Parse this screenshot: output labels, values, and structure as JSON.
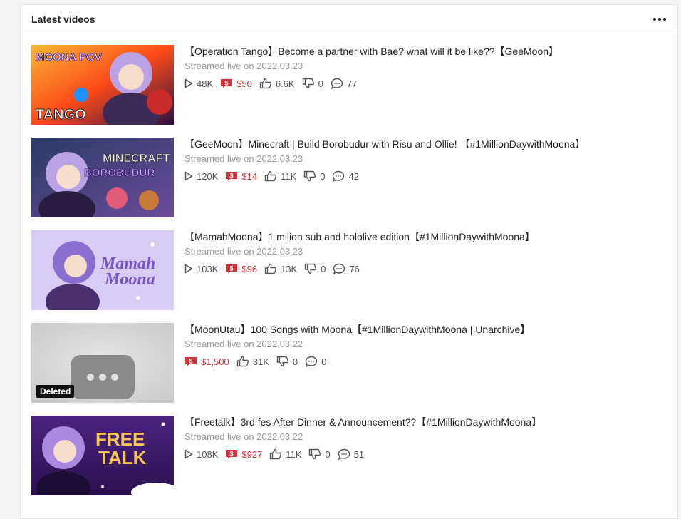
{
  "card": {
    "title": "Latest videos"
  },
  "videos": [
    {
      "title": "【Operation Tango】Become a partner with Bae? what will it be like??【GeeMoon】",
      "date": "Streamed live on 2022.03.23",
      "views": "48K",
      "superchat": "$50",
      "likes": "6.6K",
      "dislikes": "0",
      "comments": "77",
      "thumb_text": "MOONA POV",
      "thumb_text2": "TANGO"
    },
    {
      "title": "【GeeMoon】Minecraft | Build Borobudur with Risu and Ollie! 【#1MillionDaywithMoona】",
      "date": "Streamed live on 2022.03.23",
      "views": "120K",
      "superchat": "$14",
      "likes": "11K",
      "dislikes": "0",
      "comments": "42",
      "thumb_text": "MINECRAFT",
      "thumb_text2": "BOROBUDUR"
    },
    {
      "title": "【MamahMoona】1 milion sub and hololive edition【#1MillionDaywithMoona】",
      "date": "Streamed live on 2022.03.23",
      "views": "103K",
      "superchat": "$96",
      "likes": "13K",
      "dislikes": "0",
      "comments": "76",
      "thumb_text": "Mamah",
      "thumb_text2": "Moona"
    },
    {
      "title": "【MoonUtau】100 Songs with Moona【#1MillionDaywithMoona | Unarchive】",
      "date": "Streamed live on 2022.03.22",
      "superchat": "$1,500",
      "likes": "31K",
      "dislikes": "0",
      "comments": "0",
      "badge": "Deleted"
    },
    {
      "title": "【Freetalk】3rd fes After Dinner & Announcement??【#1MillionDaywithMoona】",
      "date": "Streamed live on 2022.03.22",
      "views": "108K",
      "superchat": "$927",
      "likes": "11K",
      "dislikes": "0",
      "comments": "51",
      "thumb_text": "FREE",
      "thumb_text2": "TALK"
    }
  ],
  "icons": {
    "views": "play-icon",
    "superchat": "superchat-icon",
    "likes": "thumbs-up-icon",
    "dislikes": "thumbs-down-icon",
    "comments": "comment-icon",
    "more": "more-dots-icon"
  },
  "colors": {
    "money": "#d0333a",
    "date": "#9a9a9a"
  }
}
